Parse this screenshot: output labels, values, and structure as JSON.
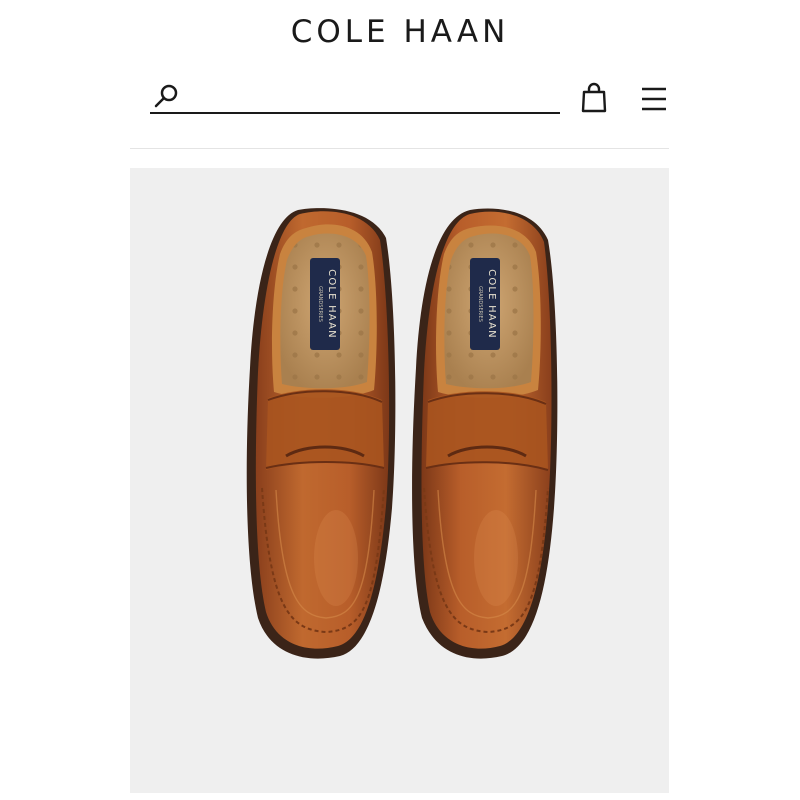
{
  "header": {
    "brand": "COLE HAAN",
    "search": {
      "value": "",
      "placeholder": ""
    },
    "icons": {
      "search": "search-icon",
      "bag": "shopping-bag-icon",
      "menu": "hamburger-menu-icon"
    }
  },
  "product": {
    "image": "penny-loafer-pair",
    "insole_label_brand": "COLE HAAN",
    "insole_label_line": "GRANDSERIES"
  },
  "colors": {
    "text": "#1a1a1a",
    "panel_bg": "#efefef",
    "leather": "#b35f2e",
    "insole": "#c49a63",
    "label_navy": "#1f2a4a"
  }
}
